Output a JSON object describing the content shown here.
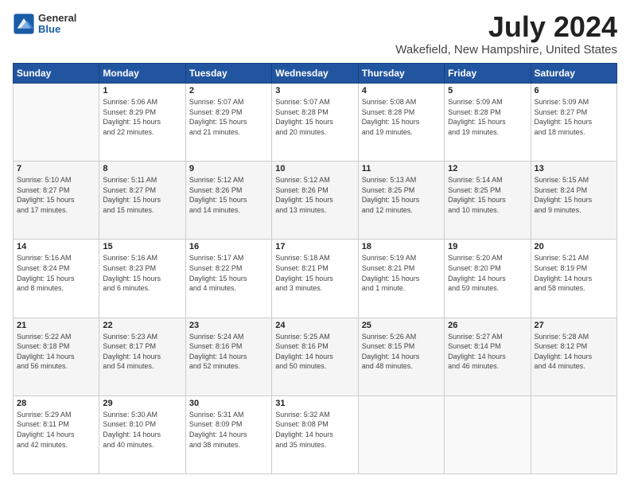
{
  "logo": {
    "general": "General",
    "blue": "Blue"
  },
  "header": {
    "month": "July 2024",
    "location": "Wakefield, New Hampshire, United States"
  },
  "weekdays": [
    "Sunday",
    "Monday",
    "Tuesday",
    "Wednesday",
    "Thursday",
    "Friday",
    "Saturday"
  ],
  "weeks": [
    [
      {
        "day": "",
        "detail": ""
      },
      {
        "day": "1",
        "detail": "Sunrise: 5:06 AM\nSunset: 8:29 PM\nDaylight: 15 hours\nand 22 minutes."
      },
      {
        "day": "2",
        "detail": "Sunrise: 5:07 AM\nSunset: 8:29 PM\nDaylight: 15 hours\nand 21 minutes."
      },
      {
        "day": "3",
        "detail": "Sunrise: 5:07 AM\nSunset: 8:28 PM\nDaylight: 15 hours\nand 20 minutes."
      },
      {
        "day": "4",
        "detail": "Sunrise: 5:08 AM\nSunset: 8:28 PM\nDaylight: 15 hours\nand 19 minutes."
      },
      {
        "day": "5",
        "detail": "Sunrise: 5:09 AM\nSunset: 8:28 PM\nDaylight: 15 hours\nand 19 minutes."
      },
      {
        "day": "6",
        "detail": "Sunrise: 5:09 AM\nSunset: 8:27 PM\nDaylight: 15 hours\nand 18 minutes."
      }
    ],
    [
      {
        "day": "7",
        "detail": "Sunrise: 5:10 AM\nSunset: 8:27 PM\nDaylight: 15 hours\nand 17 minutes."
      },
      {
        "day": "8",
        "detail": "Sunrise: 5:11 AM\nSunset: 8:27 PM\nDaylight: 15 hours\nand 15 minutes."
      },
      {
        "day": "9",
        "detail": "Sunrise: 5:12 AM\nSunset: 8:26 PM\nDaylight: 15 hours\nand 14 minutes."
      },
      {
        "day": "10",
        "detail": "Sunrise: 5:12 AM\nSunset: 8:26 PM\nDaylight: 15 hours\nand 13 minutes."
      },
      {
        "day": "11",
        "detail": "Sunrise: 5:13 AM\nSunset: 8:25 PM\nDaylight: 15 hours\nand 12 minutes."
      },
      {
        "day": "12",
        "detail": "Sunrise: 5:14 AM\nSunset: 8:25 PM\nDaylight: 15 hours\nand 10 minutes."
      },
      {
        "day": "13",
        "detail": "Sunrise: 5:15 AM\nSunset: 8:24 PM\nDaylight: 15 hours\nand 9 minutes."
      }
    ],
    [
      {
        "day": "14",
        "detail": "Sunrise: 5:16 AM\nSunset: 8:24 PM\nDaylight: 15 hours\nand 8 minutes."
      },
      {
        "day": "15",
        "detail": "Sunrise: 5:16 AM\nSunset: 8:23 PM\nDaylight: 15 hours\nand 6 minutes."
      },
      {
        "day": "16",
        "detail": "Sunrise: 5:17 AM\nSunset: 8:22 PM\nDaylight: 15 hours\nand 4 minutes."
      },
      {
        "day": "17",
        "detail": "Sunrise: 5:18 AM\nSunset: 8:21 PM\nDaylight: 15 hours\nand 3 minutes."
      },
      {
        "day": "18",
        "detail": "Sunrise: 5:19 AM\nSunset: 8:21 PM\nDaylight: 15 hours\nand 1 minute."
      },
      {
        "day": "19",
        "detail": "Sunrise: 5:20 AM\nSunset: 8:20 PM\nDaylight: 14 hours\nand 59 minutes."
      },
      {
        "day": "20",
        "detail": "Sunrise: 5:21 AM\nSunset: 8:19 PM\nDaylight: 14 hours\nand 58 minutes."
      }
    ],
    [
      {
        "day": "21",
        "detail": "Sunrise: 5:22 AM\nSunset: 8:18 PM\nDaylight: 14 hours\nand 56 minutes."
      },
      {
        "day": "22",
        "detail": "Sunrise: 5:23 AM\nSunset: 8:17 PM\nDaylight: 14 hours\nand 54 minutes."
      },
      {
        "day": "23",
        "detail": "Sunrise: 5:24 AM\nSunset: 8:16 PM\nDaylight: 14 hours\nand 52 minutes."
      },
      {
        "day": "24",
        "detail": "Sunrise: 5:25 AM\nSunset: 8:16 PM\nDaylight: 14 hours\nand 50 minutes."
      },
      {
        "day": "25",
        "detail": "Sunrise: 5:26 AM\nSunset: 8:15 PM\nDaylight: 14 hours\nand 48 minutes."
      },
      {
        "day": "26",
        "detail": "Sunrise: 5:27 AM\nSunset: 8:14 PM\nDaylight: 14 hours\nand 46 minutes."
      },
      {
        "day": "27",
        "detail": "Sunrise: 5:28 AM\nSunset: 8:12 PM\nDaylight: 14 hours\nand 44 minutes."
      }
    ],
    [
      {
        "day": "28",
        "detail": "Sunrise: 5:29 AM\nSunset: 8:11 PM\nDaylight: 14 hours\nand 42 minutes."
      },
      {
        "day": "29",
        "detail": "Sunrise: 5:30 AM\nSunset: 8:10 PM\nDaylight: 14 hours\nand 40 minutes."
      },
      {
        "day": "30",
        "detail": "Sunrise: 5:31 AM\nSunset: 8:09 PM\nDaylight: 14 hours\nand 38 minutes."
      },
      {
        "day": "31",
        "detail": "Sunrise: 5:32 AM\nSunset: 8:08 PM\nDaylight: 14 hours\nand 35 minutes."
      },
      {
        "day": "",
        "detail": ""
      },
      {
        "day": "",
        "detail": ""
      },
      {
        "day": "",
        "detail": ""
      }
    ]
  ]
}
